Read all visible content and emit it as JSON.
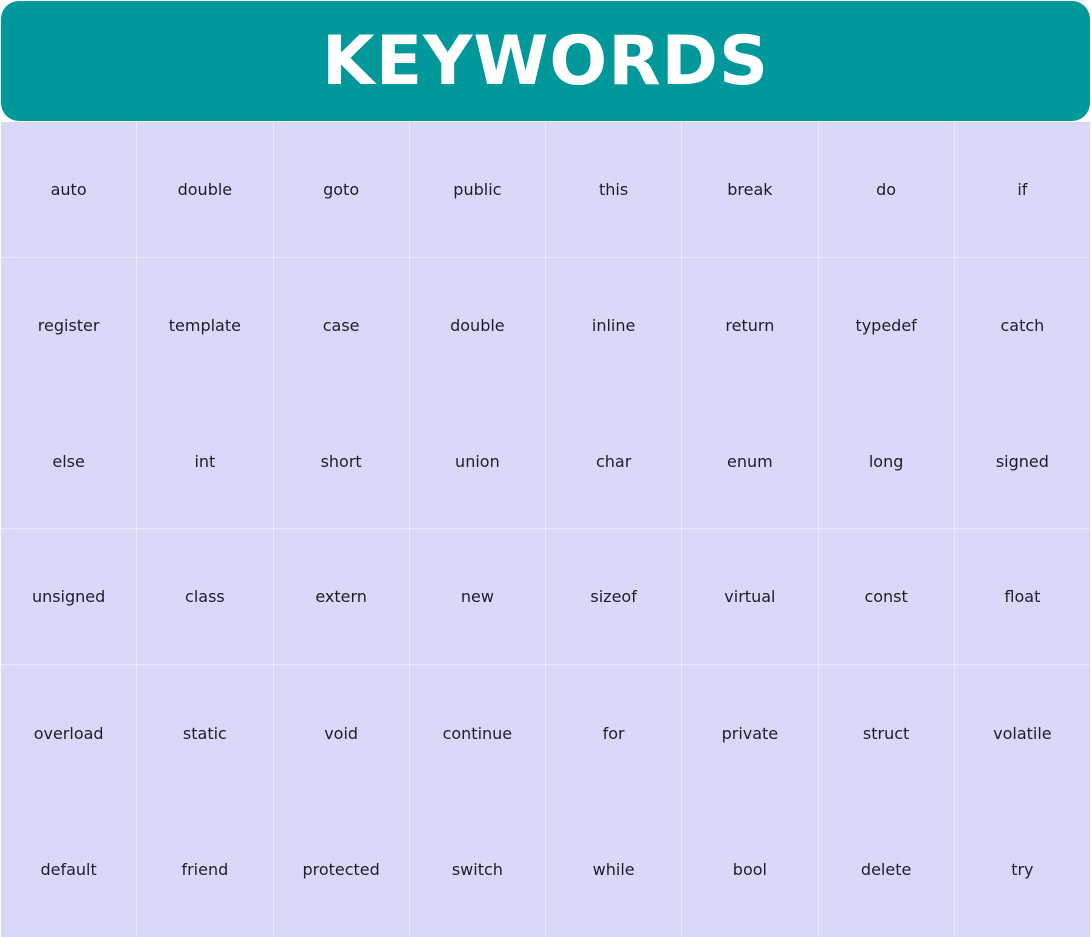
{
  "header": {
    "title": "KEYWORDS"
  },
  "colors": {
    "header_bg": "#00989a",
    "cell_bg": "#d8d8f9",
    "text": "#1e1e2a",
    "title_text": "#ffffff"
  },
  "keywords": [
    [
      "auto",
      "double",
      "goto",
      "public",
      "this",
      "break",
      "do",
      "if"
    ],
    [
      "register",
      "template",
      "case",
      "double",
      "inline",
      "return",
      "typedef",
      "catch"
    ],
    [
      "else",
      "int",
      "short",
      "union",
      "char",
      "enum",
      "long",
      "signed"
    ],
    [
      "unsigned",
      "class",
      "extern",
      "new",
      "sizeof",
      "virtual",
      "const",
      "float"
    ],
    [
      "overload",
      "static",
      "void",
      "continue",
      "for",
      "private",
      "struct",
      "volatile"
    ],
    [
      "default",
      "friend",
      "protected",
      "switch",
      "while",
      "bool",
      "delete",
      "try"
    ]
  ]
}
